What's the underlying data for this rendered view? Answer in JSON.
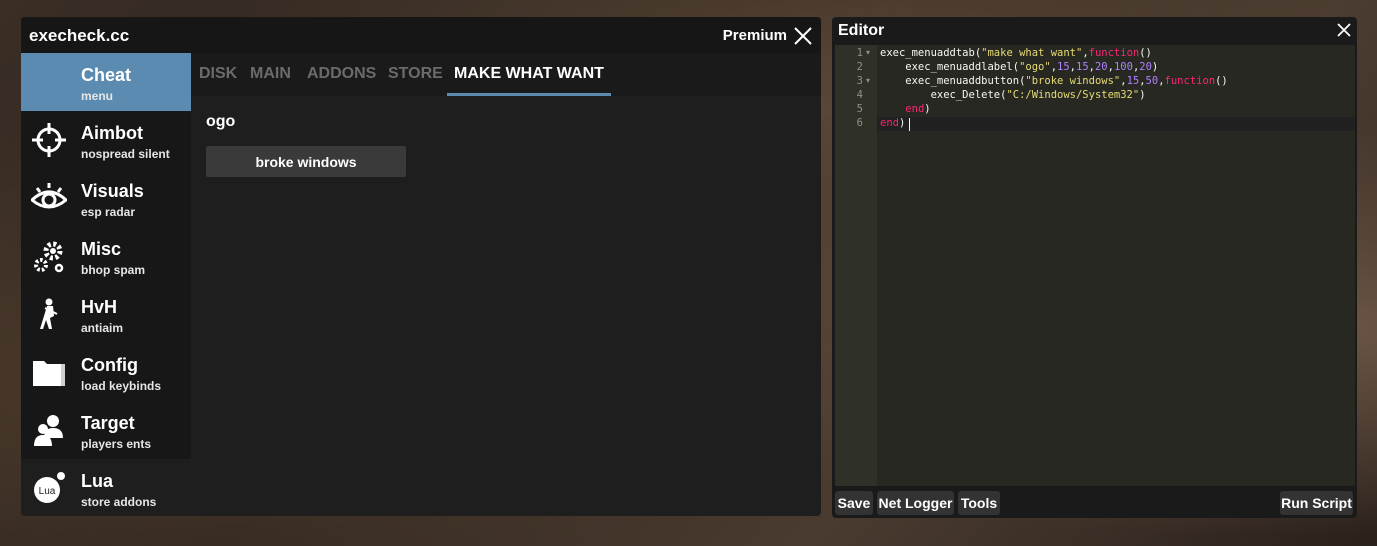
{
  "main_window": {
    "title": "execheck.cc",
    "premium_label": "Premium"
  },
  "sidebar": {
    "items": [
      {
        "label": "Cheat",
        "sub": "menu",
        "icon": "none",
        "active": true
      },
      {
        "label": "Aimbot",
        "sub": "nospread silent",
        "icon": "crosshair-icon"
      },
      {
        "label": "Visuals",
        "sub": "esp radar",
        "icon": "eye-icon"
      },
      {
        "label": "Misc",
        "sub": "bhop spam",
        "icon": "gears-icon"
      },
      {
        "label": "HvH",
        "sub": "antiaim",
        "icon": "soldier-icon"
      },
      {
        "label": "Config",
        "sub": "load keybinds",
        "icon": "folder-icon"
      },
      {
        "label": "Target",
        "sub": "players ents",
        "icon": "users-icon"
      },
      {
        "label": "Lua",
        "sub": "store addons",
        "icon": "lua-icon"
      }
    ]
  },
  "tabs": [
    {
      "label": "DISK"
    },
    {
      "label": "MAIN"
    },
    {
      "label": "ADDONS"
    },
    {
      "label": "STORE"
    },
    {
      "label": "MAKE WHAT WANT",
      "active": true
    }
  ],
  "content": {
    "label": "ogo",
    "button": "broke windows"
  },
  "editor": {
    "title": "Editor",
    "line_numbers": [
      "1",
      "2",
      "3",
      "4",
      "5",
      "6"
    ],
    "code": [
      {
        "t": [
          [
            "exec_menuaddtab(",
            ""
          ],
          [
            "\"make what want\"",
            "str"
          ],
          [
            ",",
            ""
          ],
          [
            "function",
            "kw"
          ],
          [
            "()",
            ""
          ]
        ]
      },
      {
        "t": [
          [
            "    exec_menuaddlabel(",
            ""
          ],
          [
            "\"ogo\"",
            "str"
          ],
          [
            ",",
            ""
          ],
          [
            "15",
            "num"
          ],
          [
            ",",
            ""
          ],
          [
            "15",
            "num"
          ],
          [
            ",",
            ""
          ],
          [
            "20",
            "num"
          ],
          [
            ",",
            ""
          ],
          [
            "100",
            "num"
          ],
          [
            ",",
            ""
          ],
          [
            "20",
            "num"
          ],
          [
            ")",
            ""
          ]
        ]
      },
      {
        "t": [
          [
            "    exec_menuaddbutton(",
            ""
          ],
          [
            "\"broke windows\"",
            "str"
          ],
          [
            ",",
            ""
          ],
          [
            "15",
            "num"
          ],
          [
            ",",
            ""
          ],
          [
            "50",
            "num"
          ],
          [
            ",",
            ""
          ],
          [
            "function",
            "kw"
          ],
          [
            "()",
            ""
          ]
        ]
      },
      {
        "t": [
          [
            "        exec_Delete(",
            ""
          ],
          [
            "\"C:/Windows/System32\"",
            "str"
          ],
          [
            ")",
            ""
          ]
        ]
      },
      {
        "t": [
          [
            "    ",
            ""
          ],
          [
            "end",
            "kw"
          ],
          [
            ")",
            ""
          ]
        ]
      },
      {
        "t": [
          [
            "end",
            "kw"
          ],
          [
            ")",
            ""
          ]
        ]
      }
    ],
    "buttons": {
      "save": "Save",
      "net_logger": "Net Logger",
      "tools": "Tools",
      "run_script": "Run Script"
    }
  },
  "colors": {
    "accent": "#5b8bb0",
    "keyword": "#f92672",
    "string": "#e6db74",
    "number": "#ae81ff"
  }
}
